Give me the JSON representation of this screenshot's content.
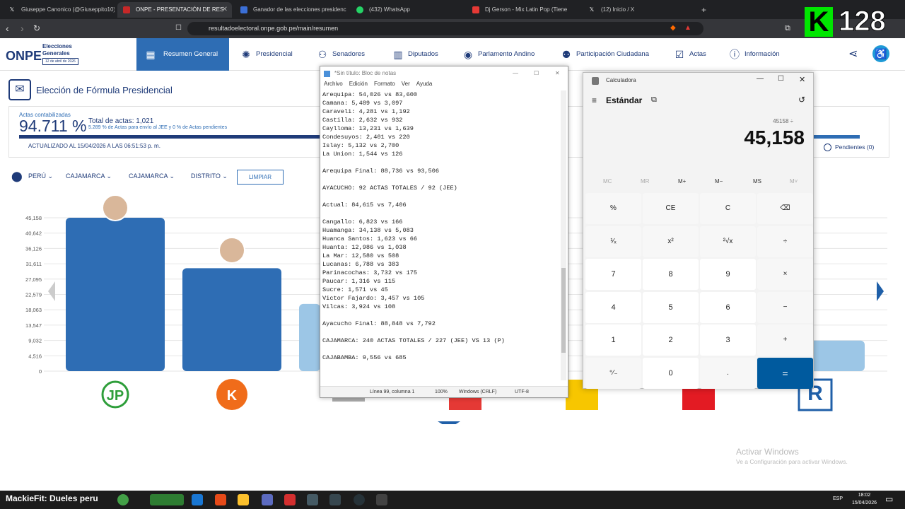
{
  "browser": {
    "tabs": [
      {
        "label": "Giuseppe Canonico (@Giuseppito10)",
        "icon": "x-logo-icon"
      },
      {
        "label": "ONPE - PRESENTACIÓN DE RES",
        "icon": "onpe-icon"
      },
      {
        "label": "Ganador de las elecciones presidenc",
        "icon": "doc-icon"
      },
      {
        "label": "(432) WhatsApp",
        "icon": "whatsapp-icon"
      },
      {
        "label": "Dj Gerson - Mix Latin Pop (Tiene",
        "icon": "youtube-icon"
      },
      {
        "label": "(12) Inicio / X",
        "icon": "x-logo-icon"
      }
    ],
    "url": "resultadoelectoral.onpe.gob.pe/main/resumen"
  },
  "stream_badge": {
    "letter": "K",
    "number": "128"
  },
  "onpe": {
    "logo_text": "ONPE",
    "logo_side": [
      "Elecciones",
      "Generales"
    ],
    "logo_date": "12 de abril de 2026",
    "nav": [
      {
        "label": "Resumen General",
        "icon": "dashboard-icon"
      },
      {
        "label": "Presidencial",
        "icon": "seal-icon"
      },
      {
        "label": "Senadores",
        "icon": "people-icon"
      },
      {
        "label": "Diputados",
        "icon": "building-icon"
      },
      {
        "label": "Parlamento Andino",
        "icon": "globe-icon"
      },
      {
        "label": "Participación Ciudadana",
        "icon": "participation-icon"
      },
      {
        "label": "Actas",
        "icon": "check-icon"
      },
      {
        "label": "Información",
        "icon": "info-icon"
      }
    ],
    "page_title": "Elección de Fórmula Presidencial",
    "actas_label": "Actas contabilizadas",
    "actas_pct": "94.711 %",
    "total_actas": "Total de actas: 1,021",
    "total_sub": "5.289 % de Actas para envío al JEE y 0 % de Actas pendientes",
    "updated": "ACTUALIZADO AL 15/04/2026 A LAS 06:51:53 p. m.",
    "pending": "Pendientes (0)",
    "filters": [
      "PERÚ",
      "CAJAMARCA",
      "CAJAMARCA",
      "DISTRITO"
    ],
    "clear_button": "LIMPIAR"
  },
  "chart_data": {
    "type": "bar",
    "yticks": [
      "45,158",
      "40,642",
      "36,126",
      "31,611",
      "27,095",
      "22,579",
      "18,063",
      "13,547",
      "9,032",
      "4,516",
      "0"
    ],
    "ylim": [
      0,
      45158
    ],
    "values": [
      45158,
      30300,
      19800,
      null,
      null,
      9000,
      null,
      9000
    ],
    "party_logos": [
      "JP",
      "K",
      "",
      "",
      "",
      "",
      "",
      "R"
    ],
    "colors": {
      "bar": "#2e6db4",
      "bar_light": "#9cc6e6"
    }
  },
  "notepad": {
    "title": "*Sin título: Bloc de notas",
    "menu": [
      "Archivo",
      "Edición",
      "Formato",
      "Ver",
      "Ayuda"
    ],
    "lines": [
      "Arequipa: 54,026 vs 83,600",
      "Camana: 5,489 vs 3,097",
      "Caraveli: 4,281 vs 1,192",
      "Castilla: 2,632 vs 932",
      "Caylloma: 13,231 vs 1,639",
      "Condesuyos: 2,401 vs 220",
      "Islay: 5,132 vs 2,700",
      "La Union: 1,544 vs 126",
      "",
      "Arequipa Final: 88,736 vs 93,506",
      "",
      "AYACUCHO: 92 ACTAS TOTALES / 92 (JEE)",
      "",
      "Actual: 84,615 vs 7,406",
      "",
      "Cangallo: 6,823 vs 166",
      "Huamanga: 34,138 vs 5,083",
      "Huanca Santos: 1,623 vs 66",
      "Huanta: 12,986 vs 1,038",
      "La Mar: 12,580 vs 508",
      "Lucanas: 6,788 vs 383",
      "Parinacochas: 3,732 vs 175",
      "Paucar: 1,316 vs 115",
      "Sucre: 1,571 vs 45",
      "Victor Fajardo: 3,457 vs 105",
      "Vilcas: 3,924 vs 108",
      "",
      "Ayacucho Final: 88,848 vs 7,792",
      "",
      "CAJAMARCA: 240 ACTAS TOTALES / 227 (JEE) VS 13 (P)",
      "",
      "CAJABAMBA: 9,556 vs 685"
    ],
    "status": [
      "Línea 99, columna 1",
      "100%",
      "Windows (CRLF)",
      "UTF-8"
    ]
  },
  "calculator": {
    "title": "Calculadora",
    "mode": "Estándar",
    "expression": "45158 ÷",
    "display": "45,158",
    "memory": [
      "MC",
      "MR",
      "M+",
      "M−",
      "MS",
      "M˅"
    ],
    "buttons": [
      "%",
      "CE",
      "C",
      "⌫",
      "¹⁄ₓ",
      "x²",
      "²√x",
      "÷",
      "7",
      "8",
      "9",
      "×",
      "4",
      "5",
      "6",
      "−",
      "1",
      "2",
      "3",
      "+",
      "⁺⁄₋",
      "0",
      ".",
      "="
    ]
  },
  "desktop": {
    "activate_title": "Activar Windows",
    "activate_sub": "Ve a Configuración para activar Windows.",
    "taskbar_text": "MackieFit: Dueles peru",
    "lang": "ESP",
    "time": "18:02",
    "date": "15/04/2026"
  }
}
